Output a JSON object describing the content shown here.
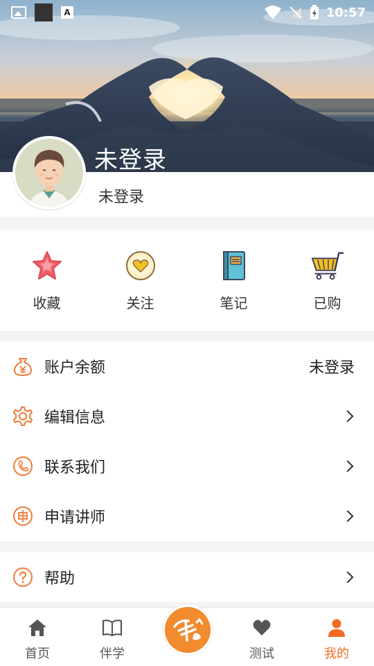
{
  "status_bar": {
    "time": "10:57"
  },
  "profile": {
    "banner_name": "未登录",
    "sub_name": "未登录"
  },
  "quick_actions": [
    {
      "label": "收藏",
      "icon": "star-icon"
    },
    {
      "label": "关注",
      "icon": "heart-badge-icon"
    },
    {
      "label": "笔记",
      "icon": "notebook-icon"
    },
    {
      "label": "已购",
      "icon": "cart-icon"
    }
  ],
  "menu": [
    {
      "label": "账户余额",
      "value": "未登录",
      "icon": "money-bag-icon"
    },
    {
      "label": "编辑信息",
      "icon": "gear-icon"
    },
    {
      "label": "联系我们",
      "icon": "phone-icon"
    },
    {
      "label": "申请讲师",
      "icon": "apply-icon"
    }
  ],
  "menu2": [
    {
      "label": "帮助",
      "icon": "help-icon"
    }
  ],
  "bottom_nav": [
    {
      "label": "首页",
      "icon": "home-icon"
    },
    {
      "label": "伴学",
      "icon": "book-icon"
    },
    {
      "label": "测试",
      "icon": "heart-icon"
    },
    {
      "label": "我的",
      "icon": "person-icon",
      "active": true
    }
  ],
  "center_button": {
    "icon": "logo-icon"
  },
  "colors": {
    "accent": "#f26a22",
    "menu_icon": "#f07a35",
    "background": "#f4f4f4"
  }
}
